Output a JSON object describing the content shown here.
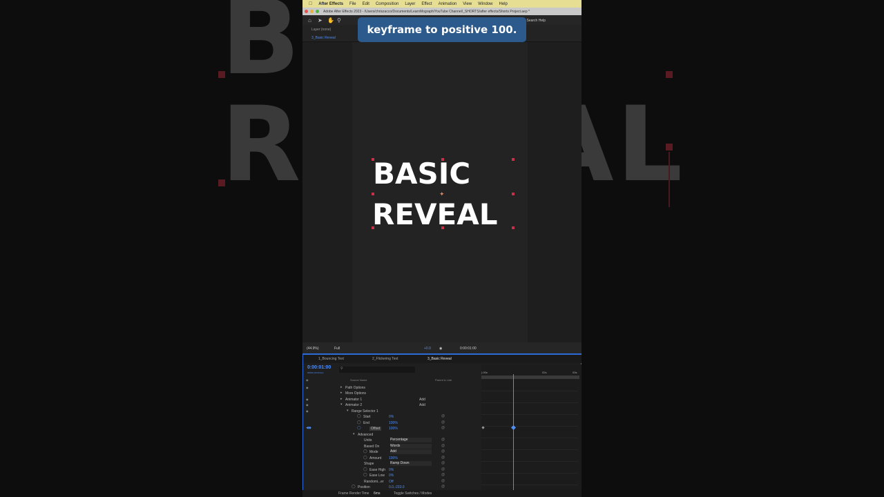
{
  "overlay_caption": "keyframe to positive 100.",
  "background_text": {
    "line1": "BASIC",
    "line2": "REVEAL"
  },
  "menubar": {
    "app_name": "After Effects",
    "items": [
      "File",
      "Edit",
      "Composition",
      "Layer",
      "Effect",
      "Animation",
      "View",
      "Window",
      "Help"
    ]
  },
  "window_title": "Adobe After Effects 2023 - /Users/chriszacco/Documents/LearnMograph/YouTube Channel/_SHORTS/after effects/Shorts Project.aep *",
  "toolbar": {
    "search_help": "Search Help"
  },
  "panel": {
    "layer_label": "Layer (none)",
    "comp_tab": "3_Basic Reveal"
  },
  "viewer": {
    "line1": "BASIC",
    "line2": "REVEAL"
  },
  "viewer_controls": {
    "zoom": "(44.9%)",
    "resolution": "Full",
    "exposure": "+0.0",
    "time": "0:00:01:00"
  },
  "timeline": {
    "tabs": [
      "1_Bouncing Text",
      "2_Flickering Text",
      "3_Basic Reveal"
    ],
    "timecode": "0:00:01:00",
    "subtimecode": "00030 (30.00 fps)",
    "columns": {
      "source_name": "Source Name",
      "parent": "Parent & Link"
    },
    "ruler": [
      "):00s",
      "02s",
      "03s"
    ],
    "rows": [
      {
        "label": "Path Options"
      },
      {
        "label": "More Options"
      },
      {
        "label": "Animator 1",
        "add": "Add"
      },
      {
        "label": "Animator 2",
        "add": "Add"
      },
      {
        "label": "Range Selector 1"
      },
      {
        "label": "Start",
        "value": "0%"
      },
      {
        "label": "End",
        "value": "100%"
      },
      {
        "label": "Offset",
        "value": "100%"
      },
      {
        "label": "Advanced"
      },
      {
        "label": "Units",
        "dropdown": "Percentage"
      },
      {
        "label": "Based On",
        "dropdown": "Words"
      },
      {
        "label": "Mode",
        "dropdown": "Add"
      },
      {
        "label": "Amount",
        "value": "100%"
      },
      {
        "label": "Shape",
        "dropdown": "Ramp Down"
      },
      {
        "label": "Ease High",
        "value": "0%"
      },
      {
        "label": "Ease Low",
        "value": "0%"
      },
      {
        "label": "Randomi...er",
        "value": "Off"
      },
      {
        "label": "Position",
        "value": "0.0,-233.0"
      }
    ],
    "footer": {
      "render_label": "Frame Render Time",
      "render_value": "6ms",
      "toggle": "Toggle Switches / Modes"
    }
  }
}
